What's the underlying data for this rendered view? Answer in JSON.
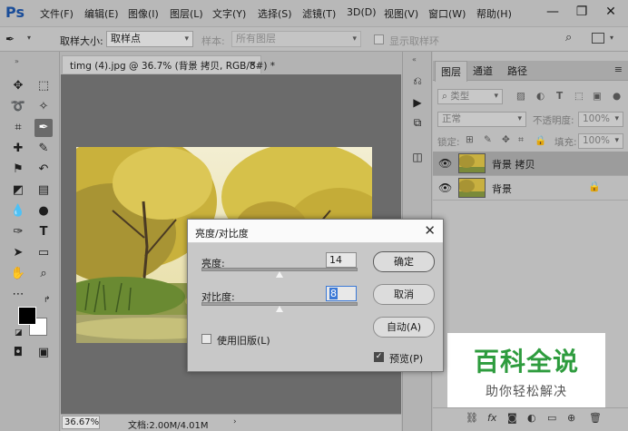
{
  "app": {
    "logo": "Ps",
    "colors": {
      "accent": "#1a4d99",
      "selection": "#3a78d6",
      "watermark_green": "#2e9c3e"
    }
  },
  "menu": [
    "文件(F)",
    "编辑(E)",
    "图像(I)",
    "图层(L)",
    "文字(Y)",
    "选择(S)",
    "滤镜(T)",
    "3D(D)",
    "视图(V)",
    "窗口(W)",
    "帮助(H)"
  ],
  "window_controls": {
    "minimize": "—",
    "restore": "❐",
    "close": "✕"
  },
  "options": {
    "sample_size_label": "取样大小:",
    "sample_size_value": "取样点",
    "sample_label": "样本:",
    "sample_value": "所有图层",
    "show_ring_label": "显示取样环"
  },
  "document": {
    "tab_title": "timg (4).jpg @ 36.7% (背景 拷贝, RGB/8#) *",
    "tab_close": "×"
  },
  "status": {
    "zoom": "36.67%",
    "doc_info": "文档:2.00M/4.01M"
  },
  "layers_panel": {
    "tabs": [
      "图层",
      "通道",
      "路径"
    ],
    "filter_kind": "类型",
    "blend_mode": "正常",
    "opacity_label": "不透明度:",
    "opacity_value": "100%",
    "lock_label": "锁定:",
    "fill_label": "填充:",
    "fill_value": "100%",
    "layers": [
      {
        "name": "背景 拷贝",
        "selected": true,
        "locked": false
      },
      {
        "name": "背景",
        "selected": false,
        "locked": true
      }
    ]
  },
  "dialog": {
    "title": "亮度/对比度",
    "brightness_label": "亮度:",
    "brightness_value": "14",
    "contrast_label": "对比度:",
    "contrast_value": "8",
    "ok_label": "确定",
    "cancel_label": "取消",
    "auto_label": "自动(A)",
    "legacy_label": "使用旧版(L)",
    "legacy_checked": false,
    "preview_label": "预览(P)",
    "preview_checked": true,
    "brightness_slider_fraction": 0.5,
    "contrast_slider_fraction": 0.5
  },
  "watermark": {
    "title": "百科全说",
    "subtitle": "助你轻松解决"
  }
}
